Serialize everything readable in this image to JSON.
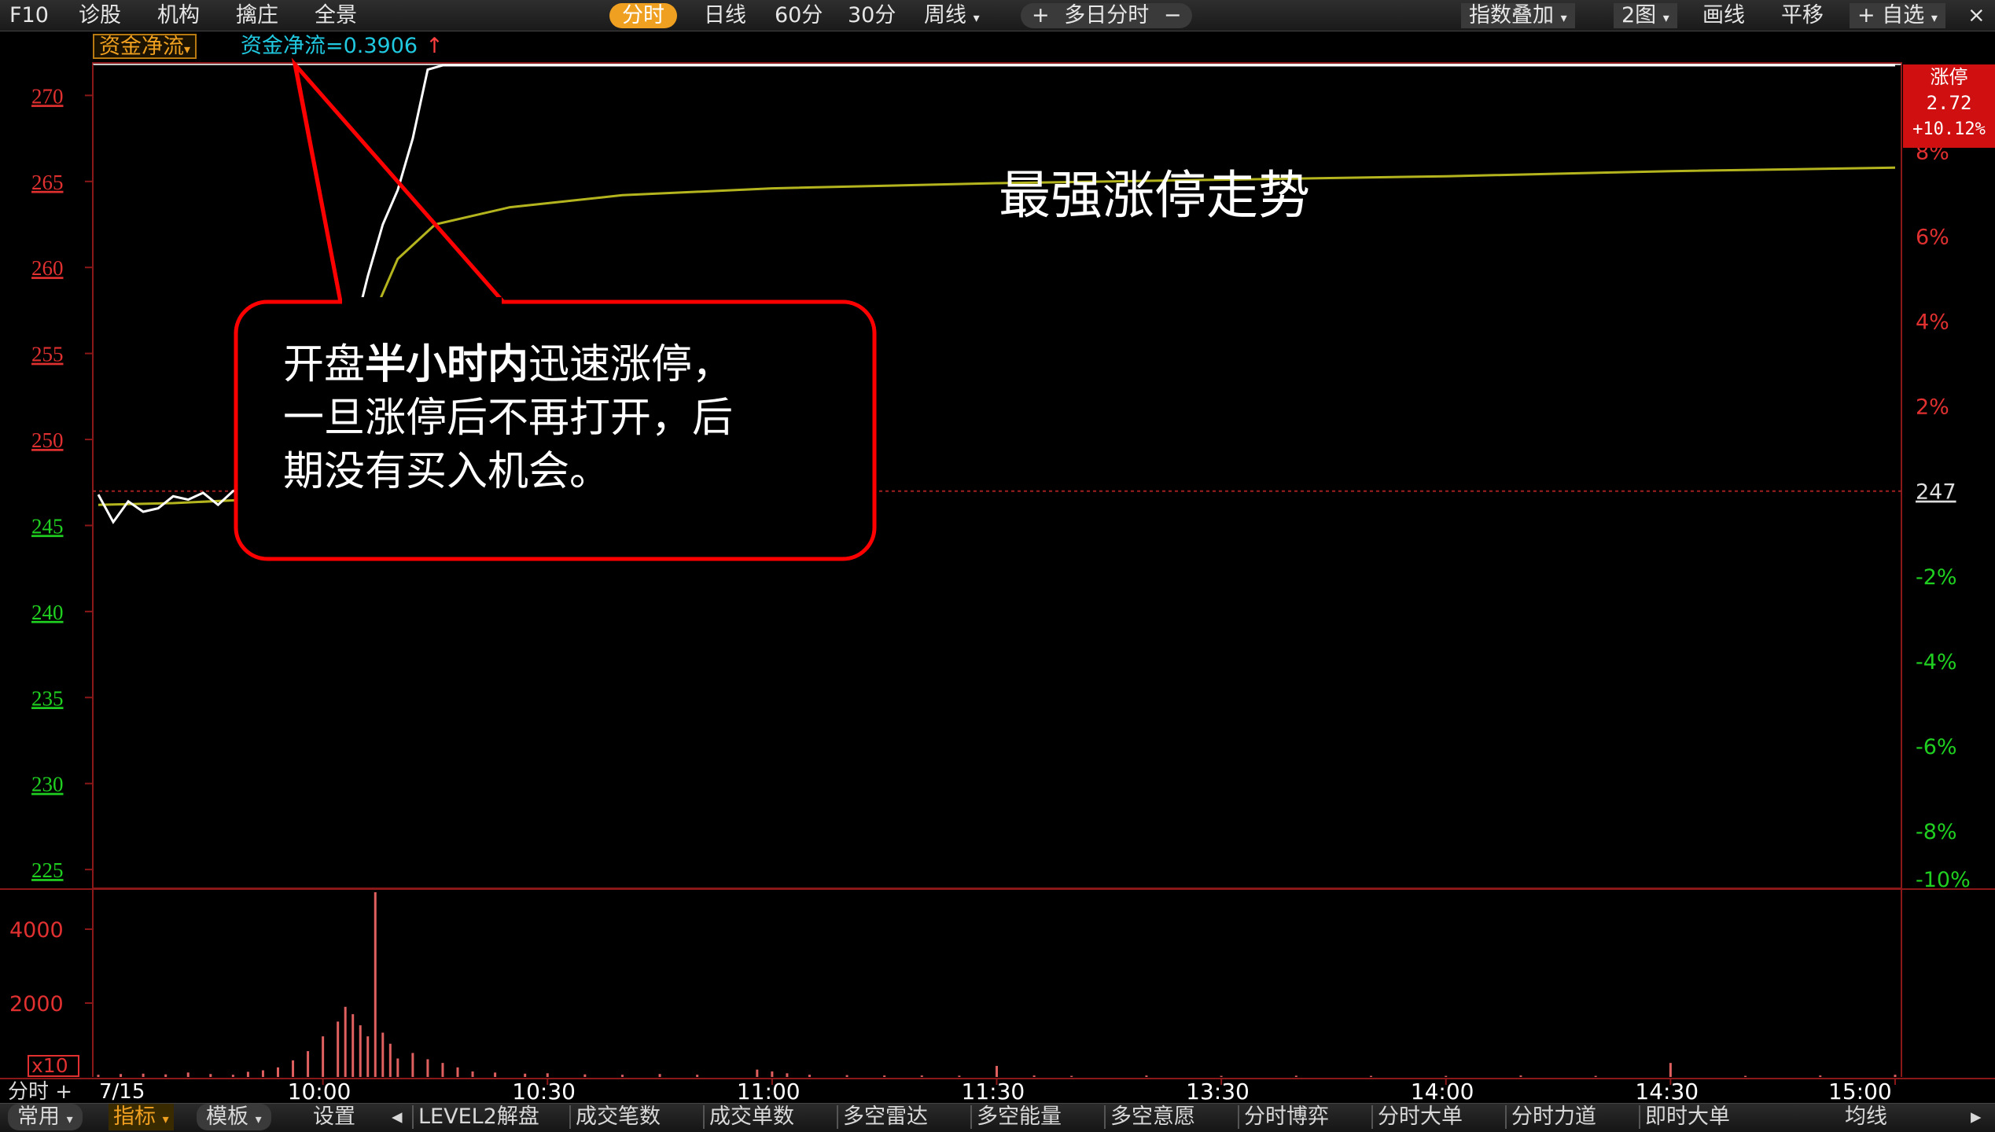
{
  "toolbar": {
    "left": [
      "F10",
      "诊股",
      "机构",
      "擒庄",
      "全景"
    ],
    "periods": [
      "分时",
      "日线",
      "60分",
      "30分"
    ],
    "active_period": "分时",
    "week_dropdown": "周线",
    "multi_day": "多日分时",
    "multi_day_plus": "+",
    "multi_day_minus": "−",
    "right": {
      "index_overlay": "指数叠加",
      "two_charts": "2图",
      "draw_line": "画线",
      "pan": "平移",
      "watchlist": "自选",
      "close": "×"
    }
  },
  "indicator": {
    "name": "资金净流",
    "value_text": "资金净流=0.3906",
    "arrow": "↑"
  },
  "limit_badge": {
    "line1": "涨停",
    "line2": "2.72",
    "line3": "+10.12%",
    "tail": "8%"
  },
  "annotations": {
    "title": "最强涨停走势",
    "callout_line1_pre": "开盘",
    "callout_line1_bold": "半小时内",
    "callout_line1_post": "迅速涨停，",
    "callout_line2": "一旦涨停后不再打开，后",
    "callout_line3": "期没有买入机会。"
  },
  "bottom": {
    "left_label": "分时",
    "date": "7/15",
    "tabs_left": [
      "常用",
      "指标",
      "模板"
    ],
    "selected_tab": "指标",
    "settings": "设置",
    "tabs": [
      "LEVEL2解盘",
      "成交笔数",
      "成交单数",
      "多空雷达",
      "多空能量",
      "多空意愿",
      "分时博弈",
      "分时大单",
      "分时力道",
      "即时大单"
    ],
    "right_tab": "均线",
    "scroll_left": "◂",
    "scroll_right": "▸"
  },
  "chart_data": {
    "type": "line",
    "price_axis": {
      "ticks": [
        270,
        265,
        260,
        255,
        250,
        245,
        240,
        235,
        230,
        225
      ],
      "ylim": [
        224,
        271.8
      ],
      "prev_close": 247
    },
    "pct_axis": {
      "ticks": [
        "8%",
        "6%",
        "4%",
        "2%",
        "247",
        "-2%",
        "-4%",
        "-6%",
        "-8%",
        "-10%"
      ]
    },
    "x_ticks": [
      "10:00",
      "10:30",
      "11:00",
      "11:30",
      "13:30",
      "14:00",
      "14:30",
      "15:00"
    ],
    "volume_axis": {
      "ticks": [
        4000,
        2000
      ],
      "unit": "x10"
    },
    "series": [
      {
        "role": "price",
        "color": "#ffffff",
        "x": [
          0,
          2,
          4,
          6,
          8,
          10,
          12,
          14,
          16,
          18,
          20,
          22,
          24,
          26,
          28,
          30,
          32,
          34,
          36,
          38,
          40,
          42,
          44,
          46,
          48,
          50,
          240
        ],
        "values": [
          246.8,
          245.2,
          246.4,
          245.8,
          246.0,
          246.7,
          246.5,
          246.9,
          246.2,
          247.0,
          247.3,
          247.7,
          247.9,
          248.5,
          249.5,
          251.0,
          253.0,
          256.0,
          259.5,
          262.5,
          264.5,
          267.5,
          271.5,
          272.0,
          272.0,
          272.0,
          272.0
        ]
      },
      {
        "role": "avg_price",
        "color": "#b4b41e",
        "x": [
          0,
          10,
          20,
          25,
          30,
          33,
          36,
          40,
          45,
          55,
          70,
          90,
          120,
          150,
          180,
          210,
          240
        ],
        "values": [
          246.2,
          246.3,
          246.5,
          247.0,
          249.0,
          252.0,
          256.5,
          260.5,
          262.5,
          263.5,
          264.2,
          264.6,
          264.9,
          265.1,
          265.3,
          265.6,
          265.8
        ]
      }
    ],
    "volume": {
      "color": "#e06060",
      "bars": [
        [
          0,
          60
        ],
        [
          3,
          80
        ],
        [
          6,
          90
        ],
        [
          9,
          70
        ],
        [
          12,
          120
        ],
        [
          15,
          80
        ],
        [
          18,
          60
        ],
        [
          20,
          140
        ],
        [
          22,
          180
        ],
        [
          24,
          260
        ],
        [
          26,
          450
        ],
        [
          28,
          700
        ],
        [
          30,
          1100
        ],
        [
          32,
          1500
        ],
        [
          33,
          1900
        ],
        [
          34,
          1700
        ],
        [
          35,
          1400
        ],
        [
          36,
          1100
        ],
        [
          37,
          5000
        ],
        [
          38,
          1200
        ],
        [
          39,
          900
        ],
        [
          40,
          500
        ],
        [
          42,
          650
        ],
        [
          44,
          480
        ],
        [
          46,
          380
        ],
        [
          48,
          260
        ],
        [
          50,
          150
        ],
        [
          53,
          120
        ],
        [
          57,
          90
        ],
        [
          60,
          100
        ],
        [
          65,
          70
        ],
        [
          70,
          60
        ],
        [
          75,
          80
        ],
        [
          80,
          60
        ],
        [
          88,
          200
        ],
        [
          90,
          150
        ],
        [
          92,
          100
        ],
        [
          95,
          60
        ],
        [
          100,
          50
        ],
        [
          105,
          40
        ],
        [
          110,
          40
        ],
        [
          115,
          35
        ],
        [
          120,
          300
        ],
        [
          125,
          40
        ],
        [
          130,
          30
        ],
        [
          140,
          40
        ],
        [
          150,
          30
        ],
        [
          160,
          35
        ],
        [
          170,
          30
        ],
        [
          180,
          30
        ],
        [
          190,
          40
        ],
        [
          200,
          30
        ],
        [
          210,
          380
        ],
        [
          220,
          30
        ],
        [
          230,
          40
        ],
        [
          240,
          60
        ]
      ]
    }
  }
}
